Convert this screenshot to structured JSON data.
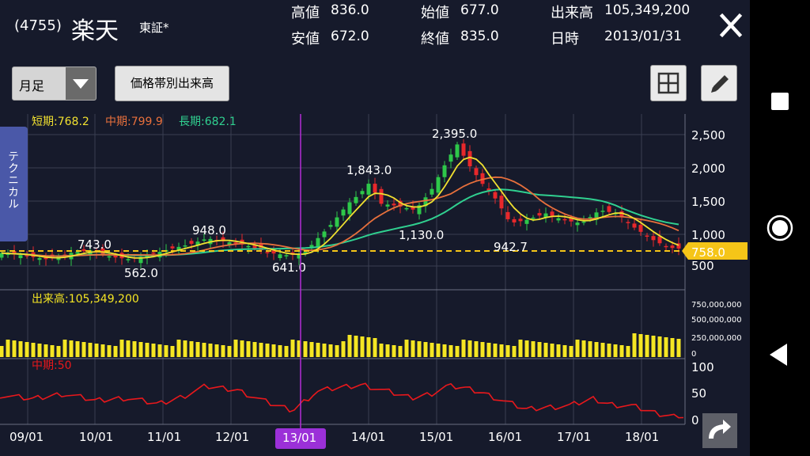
{
  "header": {
    "code": "(4755)",
    "name": "楽天",
    "market": "東証*",
    "quotes": {
      "high_label": "高値",
      "high_value": "836.0",
      "low_label": "安値",
      "low_value": "672.0",
      "open_label": "始値",
      "open_value": "677.0",
      "close_label": "終値",
      "close_value": "835.0",
      "volume_label": "出来高",
      "volume_value": "105,349,200",
      "date_label": "日時",
      "date_value": "2013/01/31"
    }
  },
  "toolbar": {
    "period": "月足",
    "volume_profile_button": "価格帯別出来高"
  },
  "side_tab": "テクニカル",
  "legend": {
    "short": "短期:768.2",
    "mid": "中期:799.9",
    "long": "長期:682.1"
  },
  "annotations": {
    "a743": "743.0",
    "a562": "562.0",
    "a948": "948.0",
    "a641": "641.0",
    "a1843": "1,843.0",
    "a2395": "2,395.0",
    "a1130": "1,130.0",
    "a9427": "942.7"
  },
  "price_axis": [
    "2,500",
    "2,000",
    "1,500",
    "1,000",
    "500"
  ],
  "current_price": "758.0",
  "volume_label": "出来高:105,349,200",
  "volume_axis": [
    "750,000,000",
    "500,000,000",
    "250,000,000",
    "0"
  ],
  "oscillator_label": "中期:50",
  "oscillator_axis": [
    "100",
    "50",
    "0"
  ],
  "x_axis": [
    "09/01",
    "10/01",
    "11/01",
    "12/01",
    "13/01",
    "14/01",
    "15/01",
    "16/01",
    "17/01",
    "18/01"
  ],
  "selected_x": "13/01",
  "colors": {
    "background": "#161a2b",
    "up": "#2ec84a",
    "down": "#e8282b",
    "short_ma": "#f0e030",
    "mid_ma": "#e8703c",
    "long_ma": "#30d090",
    "volume": "#f5e623",
    "oscillator": "#e8181c",
    "cursor": "#b32cd6",
    "price_tag": "#f5c518"
  },
  "chart_data": {
    "type": "candlestick",
    "price_ylim": [
      500,
      2500
    ],
    "annotated_prices": [
      743.0,
      562.0,
      948.0,
      641.0,
      1843.0,
      2395.0,
      1130.0,
      942.7
    ],
    "current_price": 758.0,
    "volume_axis_max": 750000000,
    "oscillator_ylim": [
      0,
      100
    ],
    "oscillator_value": 50,
    "x_categories": [
      "09/01",
      "10/01",
      "11/01",
      "12/01",
      "13/01",
      "14/01",
      "15/01",
      "16/01",
      "17/01",
      "18/01"
    ]
  },
  "nav": {
    "square": "square-icon",
    "circle": "circle-icon",
    "back": "back-icon"
  }
}
